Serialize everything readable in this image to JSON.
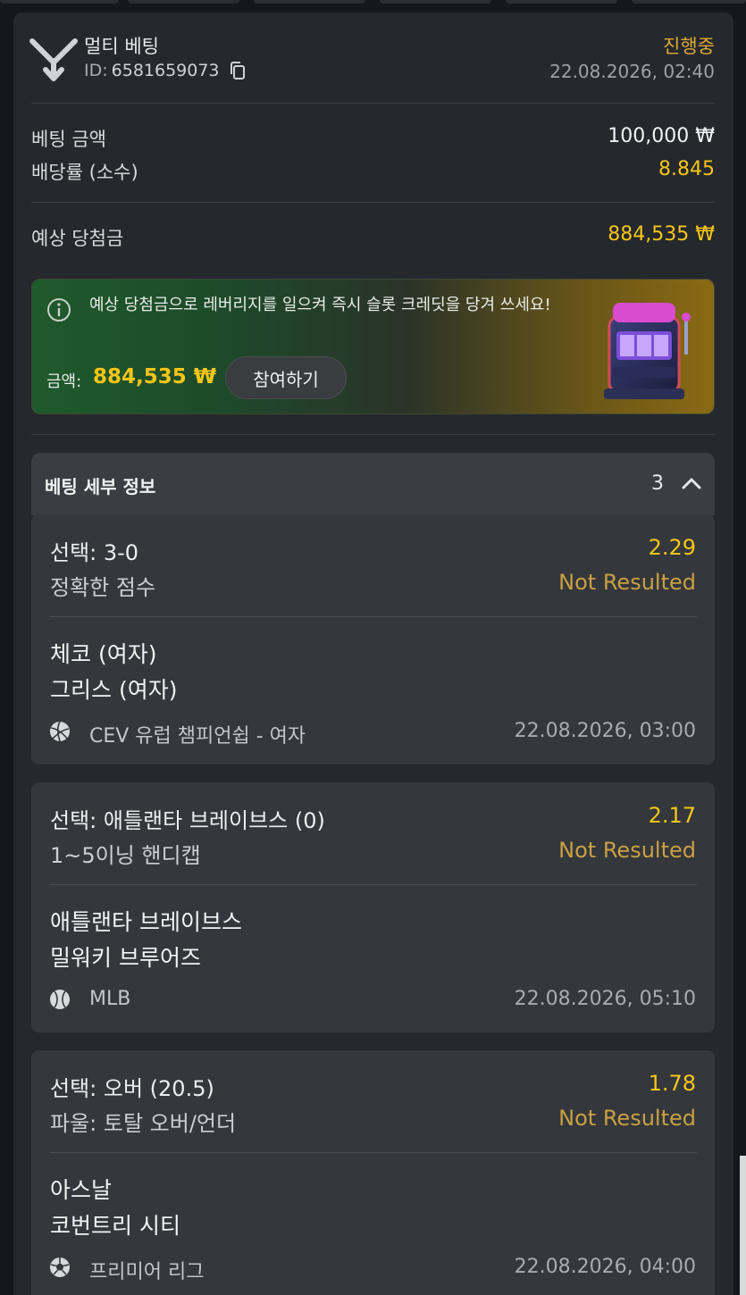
{
  "header": {
    "title": "멀티 베팅",
    "id_label": "ID:",
    "id_value": "6581659073",
    "status": "진행중",
    "datetime": "22.08.2026, 02:40"
  },
  "summary": {
    "stake_label": "베팅 금액",
    "stake_value": "100,000 ₩",
    "odds_label": "배당률 (소수)",
    "odds_value": "8.845",
    "payout_label": "예상 당첨금",
    "payout_value": "884,535 ₩"
  },
  "promo": {
    "text": "예상 당첨금으로 레버리지를 일으켜 즉시 슬롯 크레딧을 당겨 쓰세요!",
    "amount_label": "금액:",
    "amount_value": "884,535 ₩",
    "button_label": "참여하기"
  },
  "details": {
    "title": "베팅 세부 정보",
    "count": "3"
  },
  "bets": [
    {
      "selection": "선택: 3-0",
      "market": "정확한 점수",
      "odds": "2.29",
      "status": "Not Resulted",
      "team1": "체코 (여자)",
      "team2": "그리스 (여자)",
      "sport_icon": "volleyball-icon",
      "league": "CEV 유럽 챔피언쉽 - 여자",
      "datetime": "22.08.2026, 03:00"
    },
    {
      "selection": "선택: 애틀랜타 브레이브스 (0)",
      "market": "1~5이닝 핸디캡",
      "odds": "2.17",
      "status": "Not Resulted",
      "team1": "애틀랜타 브레이브스",
      "team2": "밀워키 브루어즈",
      "sport_icon": "baseball-icon",
      "league": "MLB",
      "datetime": "22.08.2026, 05:10"
    },
    {
      "selection": "선택: 오버 (20.5)",
      "market": "파울: 토탈 오버/언더",
      "odds": "1.78",
      "status": "Not Resulted",
      "team1": "아스날",
      "team2": "코번트리 시티",
      "sport_icon": "soccer-ball-icon",
      "league": "프리미어 리그",
      "datetime": "22.08.2026, 04:00"
    }
  ],
  "colors": {
    "accent_yellow": "#f5c518",
    "status_orange": "#e0a838",
    "card_bg": "#25282c"
  }
}
